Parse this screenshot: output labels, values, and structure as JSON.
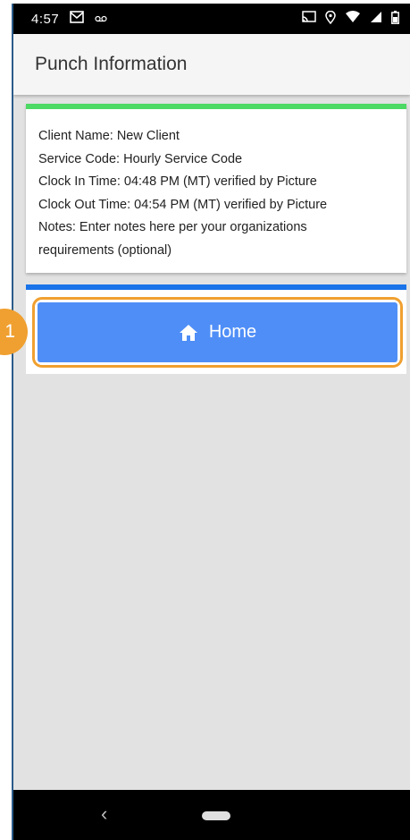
{
  "status_bar": {
    "time": "4:57",
    "left_icons": [
      "mail-icon",
      "voicemail-icon"
    ],
    "right_icons": [
      "cast-icon",
      "location-icon",
      "wifi-icon",
      "signal-icon",
      "battery-icon"
    ]
  },
  "header": {
    "title": "Punch Information"
  },
  "punch_info": {
    "client_name": "Client Name: New Client",
    "service_code": "Service Code: Hourly Service Code",
    "clock_in": "Clock In Time: 04:48 PM (MT) verified by Picture",
    "clock_out": "Clock Out Time: 04:54 PM (MT) verified by Picture",
    "notes_line1": "Notes: Enter notes here per your organizations",
    "notes_line2": "requirements (optional)"
  },
  "home_button": {
    "label": "Home",
    "icon": "home-icon"
  },
  "step_badge": {
    "number": "1"
  },
  "nav_bar": {
    "back_glyph": "‹"
  },
  "colors": {
    "status_accent": "#4cd964",
    "card_accent": "#1a73e8",
    "button": "#4f8ef7",
    "highlight": "#f0a030",
    "background": "#e2e2e2"
  }
}
